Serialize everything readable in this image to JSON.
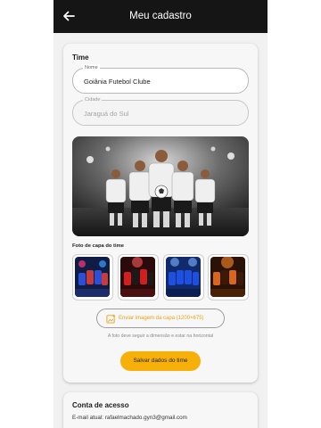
{
  "appbar": {
    "back_icon": "arrow-left-icon",
    "title": "Meu cadastro"
  },
  "team": {
    "section_title": "Time",
    "name_field": {
      "label": "Nome",
      "value": "Goiânia Futebol Clube"
    },
    "city_field": {
      "label": "Cidade",
      "value": "Jaraguá do Sul"
    },
    "cover_label": "Foto de capa do time",
    "cover_options": [
      {
        "icon": "team-photo-blue"
      },
      {
        "icon": "team-photo-red"
      },
      {
        "icon": "team-photo-blue-stadium"
      },
      {
        "icon": "team-photo-orange"
      }
    ],
    "upload_button": "Enviar imagem da capa (1200×675)",
    "upload_hint": "A foto deve seguir a dimensão e estar na horizontal",
    "save_button": "Salvar dados do time"
  },
  "account": {
    "section_title": "Conta de acesso",
    "email_text": "E-mail atual: rafaelmachado.gyn3@gmail.com"
  },
  "colors": {
    "appbar": "#151515",
    "accent": "#f6b009",
    "accent_text": "#e9a317",
    "background": "#f1f1f1"
  }
}
